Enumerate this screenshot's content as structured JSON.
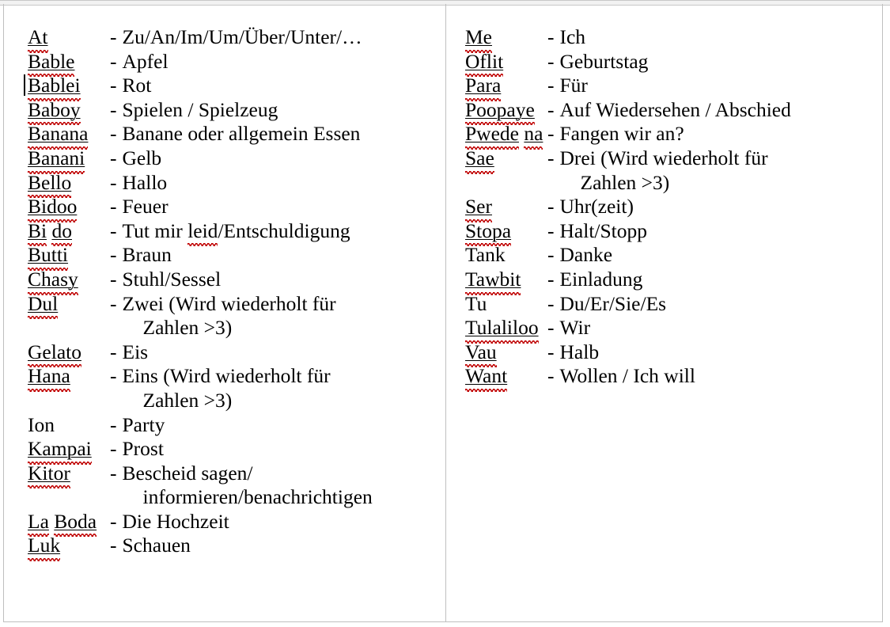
{
  "document": {
    "title": "Minion Vocabulary List (German)",
    "separator": "-",
    "spellcheck_underline_color": "#c00000",
    "text_color": "#000000",
    "border_color": "#bfbfbf",
    "caret_visible": true,
    "caret_at_entry": "Bablei"
  },
  "columns": [
    {
      "name": "left-column",
      "entries": [
        {
          "term": "At",
          "spellcheck": true,
          "definition": "Zu/An/Im/Um/Über/Unter/…"
        },
        {
          "term": "Bable",
          "spellcheck": true,
          "definition": "Apfel"
        },
        {
          "term": "Bablei",
          "spellcheck": true,
          "definition": "Rot",
          "caret": true
        },
        {
          "term": "Baboy",
          "spellcheck": true,
          "definition": "Spielen / Spielzeug"
        },
        {
          "term": "Banana",
          "spellcheck": true,
          "definition": "Banane oder allgemein Essen"
        },
        {
          "term": "Banani",
          "spellcheck": true,
          "definition": "Gelb"
        },
        {
          "term": "Bello",
          "spellcheck": true,
          "definition": "Hallo"
        },
        {
          "term": "Bidoo",
          "spellcheck": true,
          "definition": "Feuer"
        },
        {
          "term": "Bi do",
          "spellcheck": true,
          "multiword": true,
          "definition": "Tut mir leid/Entschuldigung",
          "definition_spellcheck_word": "leid"
        },
        {
          "term": "Butti",
          "spellcheck": true,
          "definition": "Braun"
        },
        {
          "term": "Chasy",
          "spellcheck": true,
          "definition": "Stuhl/Sessel"
        },
        {
          "term": "Dul",
          "spellcheck": true,
          "definition": "Zwei (Wird wiederholt für",
          "continuation": "Zahlen >3)"
        },
        {
          "term": "Gelato",
          "spellcheck": true,
          "definition": "Eis"
        },
        {
          "term": "Hana",
          "spellcheck": true,
          "definition": "Eins (Wird wiederholt für",
          "continuation": "Zahlen >3)"
        },
        {
          "term": "Ion",
          "spellcheck": false,
          "definition": "Party"
        },
        {
          "term": "Kampai",
          "spellcheck": true,
          "definition": "Prost"
        },
        {
          "term": "Kitor",
          "spellcheck": true,
          "definition": "Bescheid sagen/",
          "continuation": "informieren/benachrichtigen"
        },
        {
          "term": "La Boda",
          "spellcheck": true,
          "multiword": true,
          "definition": "Die Hochzeit"
        },
        {
          "term": "Luk",
          "spellcheck": true,
          "definition": "Schauen"
        }
      ]
    },
    {
      "name": "right-column",
      "entries": [
        {
          "term": "Me",
          "spellcheck": true,
          "definition": "Ich"
        },
        {
          "term": "Oflit",
          "spellcheck": true,
          "definition": "Geburtstag"
        },
        {
          "term": "Para",
          "spellcheck": true,
          "definition": "Für"
        },
        {
          "term": "Poopaye",
          "spellcheck": true,
          "definition": "Auf Wiedersehen / Abschied"
        },
        {
          "term": "Pwede na",
          "spellcheck": true,
          "multiword": true,
          "definition": "Fangen wir an?"
        },
        {
          "term": "Sae",
          "spellcheck": true,
          "definition": "Drei (Wird wiederholt für",
          "continuation": "Zahlen >3)"
        },
        {
          "term": "Ser",
          "spellcheck": true,
          "definition": "Uhr(zeit)"
        },
        {
          "term": "Stopa",
          "spellcheck": true,
          "definition": "Halt/Stopp"
        },
        {
          "term": "Tank",
          "spellcheck": false,
          "definition": "Danke"
        },
        {
          "term": "Tawbit",
          "spellcheck": true,
          "definition": "Einladung"
        },
        {
          "term": "Tu",
          "spellcheck": false,
          "definition": "Du/Er/Sie/Es"
        },
        {
          "term": "Tulaliloo",
          "spellcheck": true,
          "definition": "Wir"
        },
        {
          "term": "Vau",
          "spellcheck": true,
          "definition": "Halb"
        },
        {
          "term": "Want",
          "spellcheck": true,
          "definition": "Wollen / Ich will"
        }
      ]
    }
  ]
}
